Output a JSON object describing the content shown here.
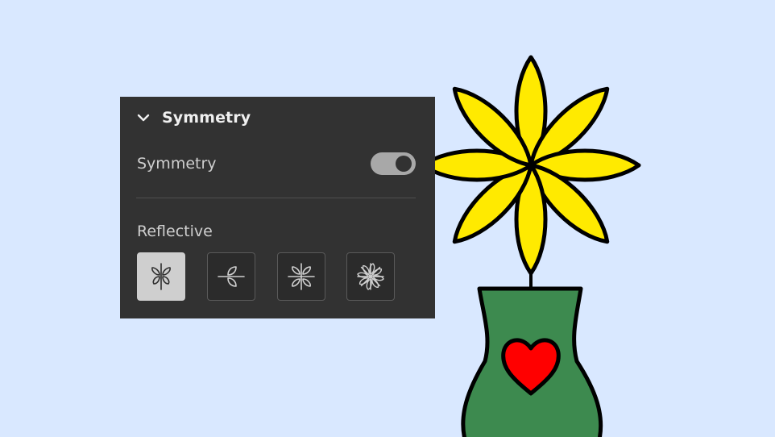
{
  "panel": {
    "title": "Symmetry",
    "symmetry_label": "Symmetry",
    "symmetry_enabled": true,
    "section_label": "Reflective",
    "modes": [
      {
        "name": "vertical-reflection",
        "icon": "butterfly-vertical-icon",
        "selected": true
      },
      {
        "name": "horizontal-reflection",
        "icon": "leaf-horizontal-icon",
        "selected": false
      },
      {
        "name": "quad-reflection",
        "icon": "butterfly-quad-icon",
        "selected": false
      },
      {
        "name": "radial-reflection",
        "icon": "flower-radial-icon",
        "selected": false
      }
    ]
  },
  "artwork": {
    "petal_color": "#ffea00",
    "vase_color": "#3d8a4f",
    "heart_color": "#ff0000",
    "outline_color": "#000000",
    "background_color": "#d9e8ff"
  }
}
